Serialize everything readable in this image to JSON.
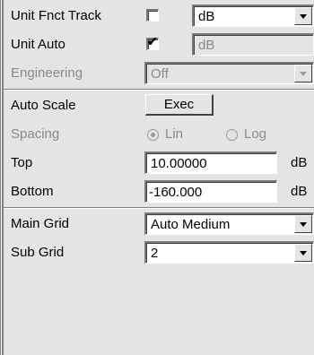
{
  "colors": {
    "panel_bg": "#e4e4e4",
    "disabled_text": "#8a8a8a",
    "field_bg": "#ffffff"
  },
  "rows": {
    "unit_fnct_track": {
      "label": "Unit Fnct Track",
      "checked": false,
      "dropdown_value": "dB"
    },
    "unit_auto": {
      "label": "Unit Auto",
      "checked": true,
      "dropdown_value": "dB"
    },
    "engineering": {
      "label": "Engineering",
      "dropdown_value": "Off"
    },
    "auto_scale": {
      "label": "Auto Scale",
      "button_label": "Exec"
    },
    "spacing": {
      "label": "Spacing",
      "option_lin": "Lin",
      "option_log": "Log",
      "selected": "Lin"
    },
    "top": {
      "label": "Top",
      "value": "10.00000",
      "unit": "dB"
    },
    "bottom": {
      "label": "Bottom",
      "value": "-160.000",
      "unit": "dB"
    },
    "main_grid": {
      "label": "Main Grid",
      "dropdown_value": "Auto Medium"
    },
    "sub_grid": {
      "label": "Sub Grid",
      "dropdown_value": "2"
    }
  },
  "icons": {
    "check": "✔",
    "dropdown": "chevron-down-icon"
  }
}
